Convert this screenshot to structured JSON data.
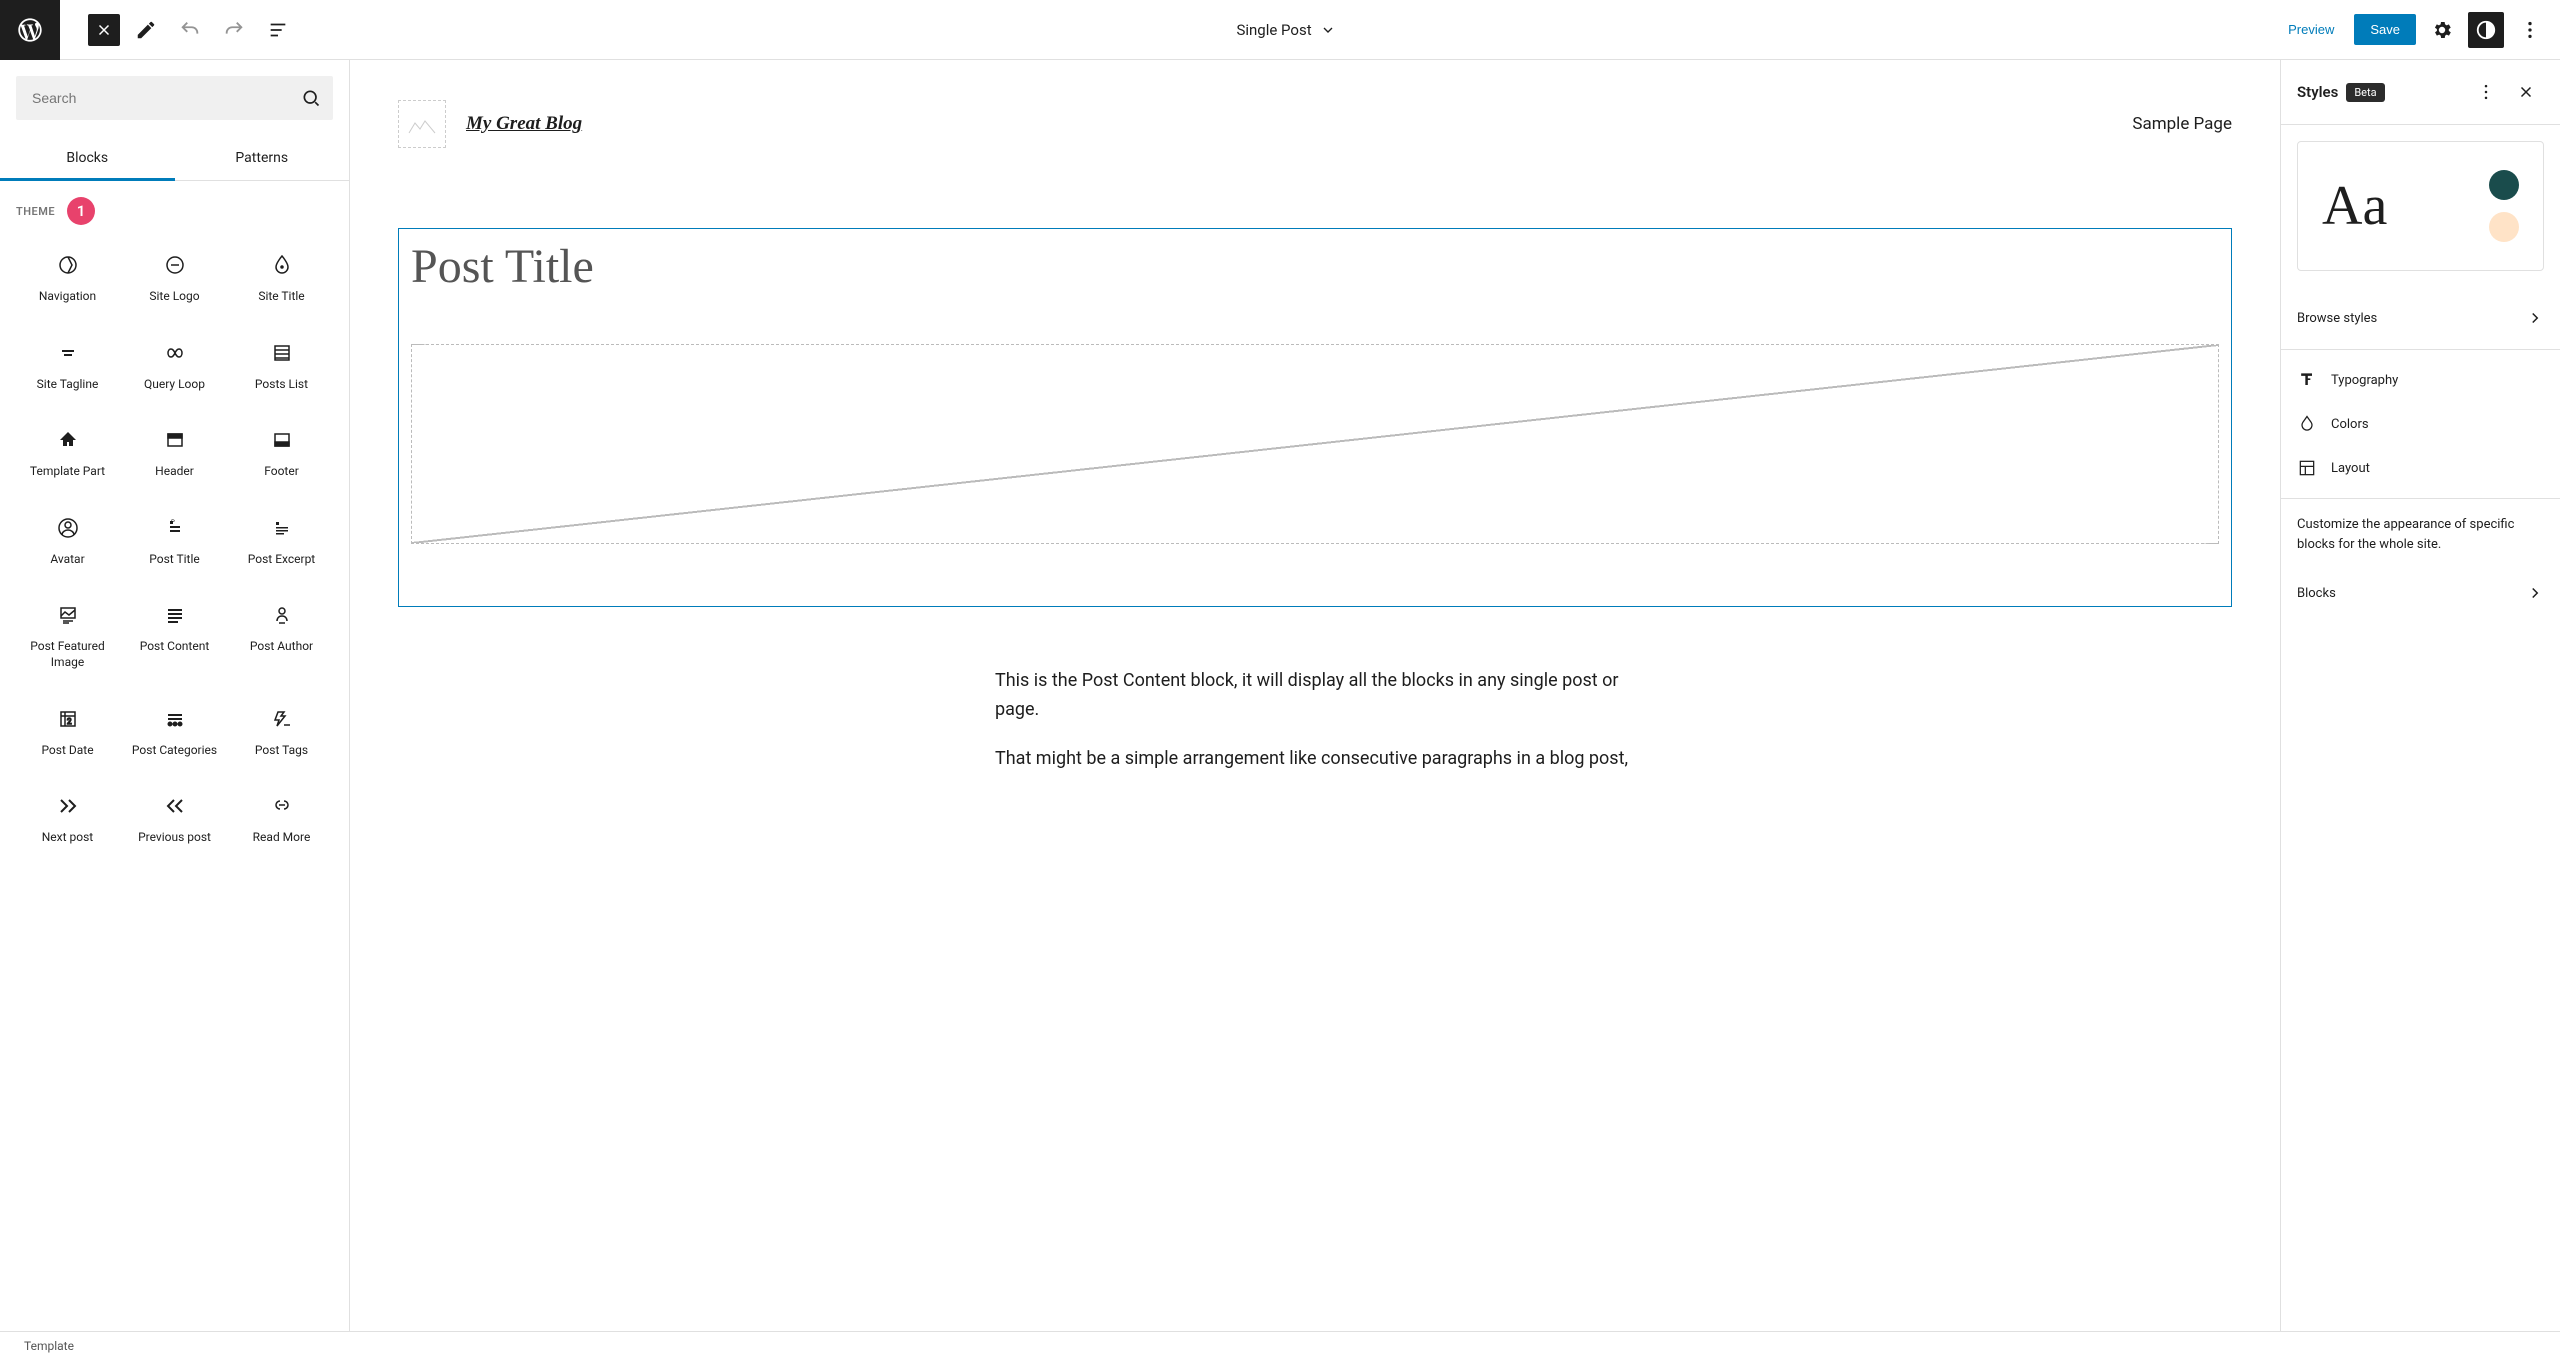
{
  "topbar": {
    "template_name": "Single Post",
    "preview_label": "Preview",
    "save_label": "Save"
  },
  "inserter": {
    "search_placeholder": "Search",
    "tabs": {
      "blocks": "Blocks",
      "patterns": "Patterns"
    },
    "section_title": "THEME",
    "badge": "1",
    "blocks": [
      {
        "label": "Navigation"
      },
      {
        "label": "Site Logo"
      },
      {
        "label": "Site Title"
      },
      {
        "label": "Site Tagline"
      },
      {
        "label": "Query Loop"
      },
      {
        "label": "Posts List"
      },
      {
        "label": "Template Part"
      },
      {
        "label": "Header"
      },
      {
        "label": "Footer"
      },
      {
        "label": "Avatar"
      },
      {
        "label": "Post Title"
      },
      {
        "label": "Post Excerpt"
      },
      {
        "label": "Post Featured Image"
      },
      {
        "label": "Post Content"
      },
      {
        "label": "Post Author"
      },
      {
        "label": "Post Date"
      },
      {
        "label": "Post Categories"
      },
      {
        "label": "Post Tags"
      },
      {
        "label": "Next post"
      },
      {
        "label": "Previous post"
      },
      {
        "label": "Read More"
      }
    ]
  },
  "canvas": {
    "site_title": "My Great Blog",
    "nav_item": "Sample Page",
    "post_title": "Post Title",
    "content_p1": "This is the Post Content block, it will display all the blocks in any single post or page.",
    "content_p2": "That might be a simple arrangement like consecutive paragraphs in a blog post,"
  },
  "styles": {
    "title": "Styles",
    "beta": "Beta",
    "preview_text": "Aa",
    "colors": {
      "accent": "#1a4c4c",
      "secondary": "#ffe3c7"
    },
    "browse": "Browse styles",
    "typography": "Typography",
    "colors_label": "Colors",
    "layout": "Layout",
    "blocks_desc": "Customize the appearance of specific blocks for the whole site.",
    "blocks_label": "Blocks"
  },
  "footer": {
    "breadcrumb": "Template"
  }
}
